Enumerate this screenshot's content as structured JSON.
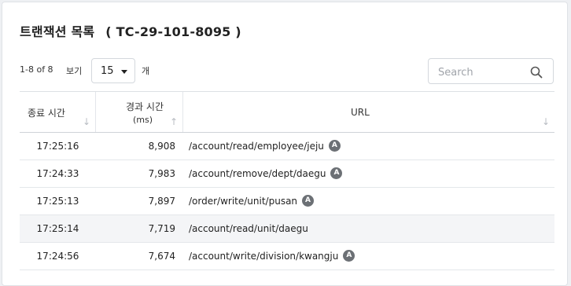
{
  "header": {
    "title": "트랜잭션 목록",
    "tc": "( TC-29-101-8095 )"
  },
  "toolbar": {
    "range": "1-8 of 8",
    "per_page_label": "보기",
    "per_page_value": "15",
    "unit_label": "개",
    "search_placeholder": "Search"
  },
  "table": {
    "headers": {
      "end_time": "종료 시간",
      "elapsed_line1": "경과 시간",
      "elapsed_line2": "(ms)",
      "url": "URL"
    },
    "rows": [
      {
        "time": "17:25:16",
        "elapsed": "8,908",
        "url": "/account/read/employee/jeju",
        "badge": "A"
      },
      {
        "time": "17:24:33",
        "elapsed": "7,983",
        "url": "/account/remove/dept/daegu",
        "badge": "A"
      },
      {
        "time": "17:25:13",
        "elapsed": "7,897",
        "url": "/order/write/unit/pusan",
        "badge": "A"
      },
      {
        "time": "17:25:14",
        "elapsed": "7,719",
        "url": "/account/read/unit/daegu",
        "badge": ""
      },
      {
        "time": "17:24:56",
        "elapsed": "7,674",
        "url": "/account/write/division/kwangju",
        "badge": "A"
      }
    ]
  },
  "colors": {
    "badge": "#6c7075",
    "highlight_row": "#f4f5f7",
    "border": "#dfe2e6"
  },
  "icons": {
    "search": "search-icon",
    "dropdown": "chevron-down-icon",
    "sort_down": "arrow-down-icon",
    "sort_up": "arrow-up-icon"
  }
}
